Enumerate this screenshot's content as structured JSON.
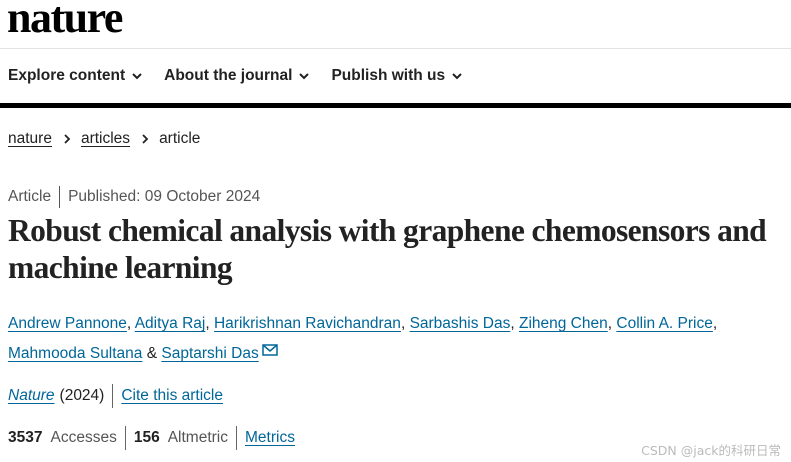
{
  "site": {
    "logo": "nature"
  },
  "nav": {
    "items": [
      {
        "label": "Explore content"
      },
      {
        "label": "About the journal"
      },
      {
        "label": "Publish with us"
      }
    ]
  },
  "breadcrumb": {
    "items": [
      "nature",
      "articles"
    ],
    "current": "article"
  },
  "article": {
    "type": "Article",
    "published": "Published: 09 October 2024",
    "title": "Robust chemical analysis with graphene chemosensors and machine learning",
    "authors": [
      "Andrew Pannone",
      "Aditya Raj",
      "Harikrishnan Ravichandran",
      "Sarbashis Das",
      "Ziheng Chen",
      "Collin A. Price",
      "Mahmooda Sultana",
      "Saptarshi Das"
    ],
    "journal": "Nature",
    "year": "(2024)",
    "cite_label": "Cite this article",
    "accesses_count": "3537",
    "accesses_label": "Accesses",
    "altmetric_count": "156",
    "altmetric_label": "Altmetric",
    "metrics_link": "Metrics"
  },
  "watermark": "CSDN @jack的科研日常",
  "colors": {
    "link": "#006699",
    "text": "#222222",
    "muted": "#555555",
    "nav_bar": "#000000"
  },
  "icons": {
    "chevron_down": "chevron-down-icon",
    "chevron_right": "chevron-right-icon",
    "mail": "mail-icon"
  }
}
